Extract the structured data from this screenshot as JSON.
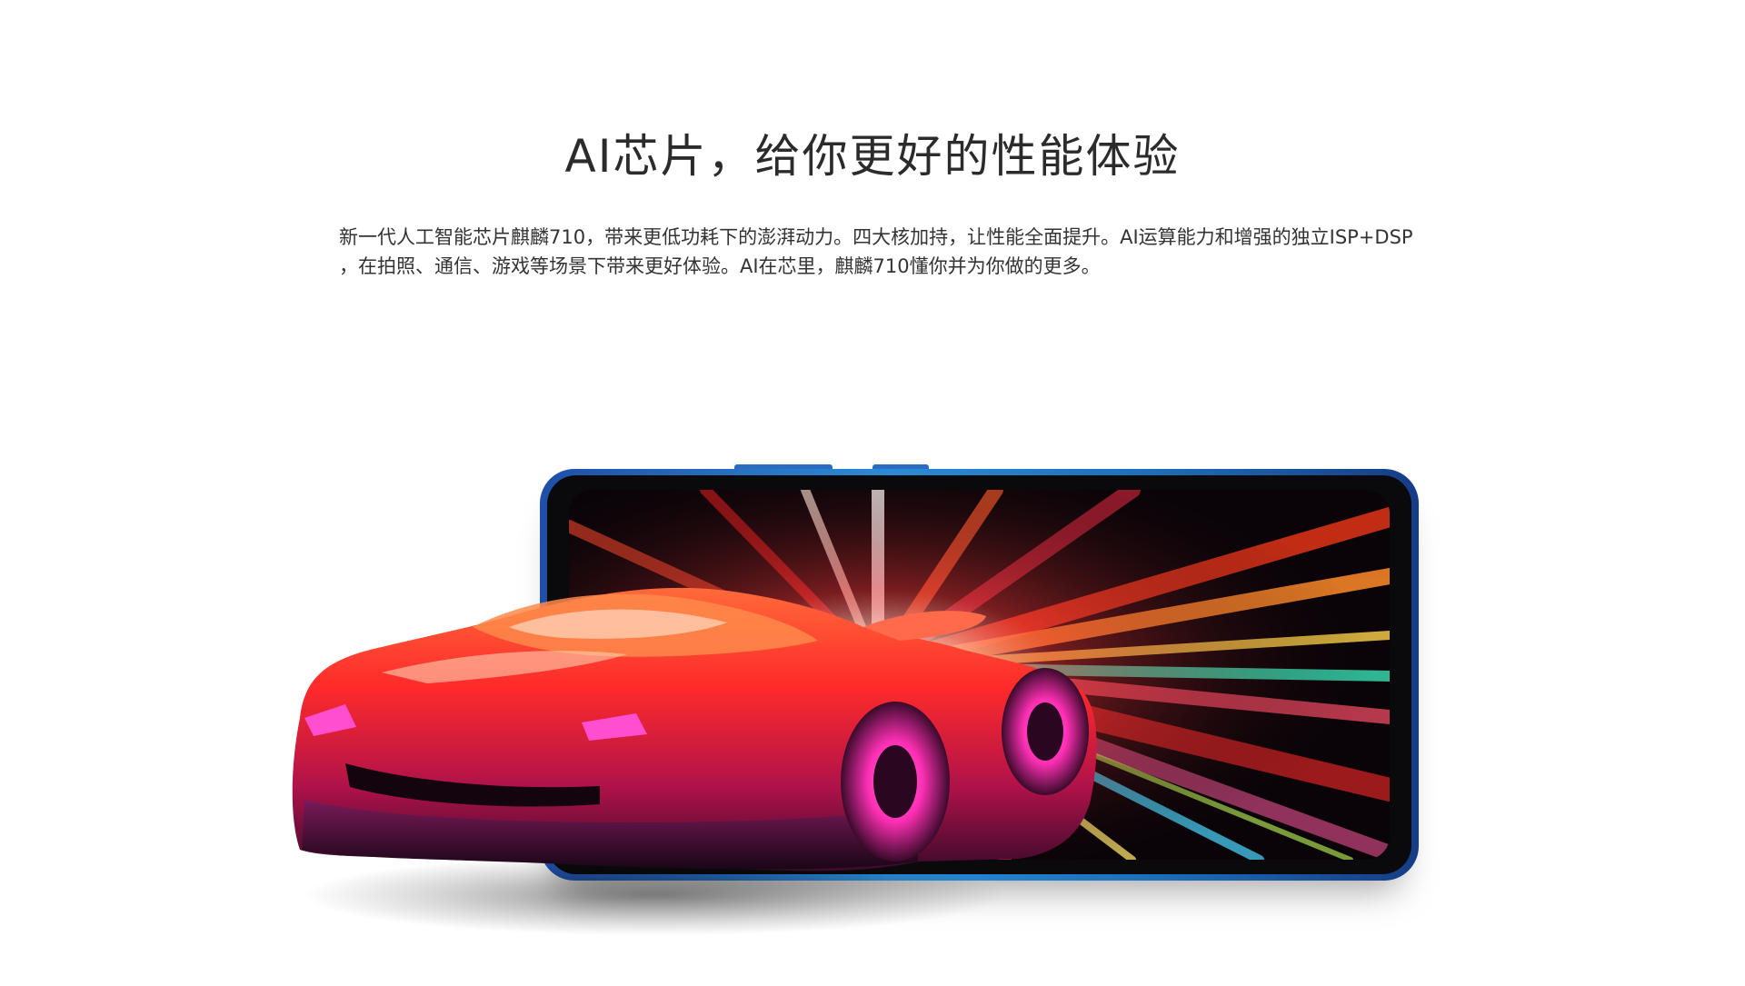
{
  "section": {
    "headline": "AI芯片，给你更好的性能体验",
    "description": "新一代人工智能芯片麒麟710，带来更低功耗下的澎湃动力。四大核加持，让性能全面提升。AI运算能力和增强的独立ISP+DSP ，在拍照、通信、游戏等场景下带来更好体验。AI在芯里，麒麟710懂你并为你做的更多。"
  },
  "hero": {
    "phone_color": "#2b8bd6",
    "screen_theme": "light-speed rays",
    "car_colors": [
      "#ff3a2a",
      "#ff7a3c",
      "#c8124a",
      "#ff2fb5",
      "#6a1a55"
    ]
  }
}
